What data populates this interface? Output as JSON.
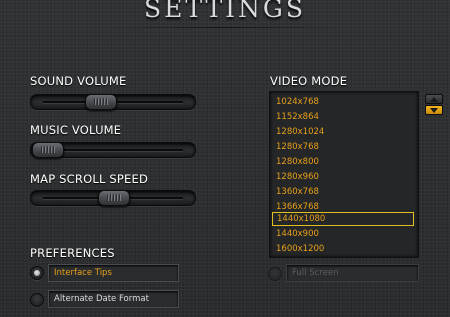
{
  "title": "SETTINGS",
  "sliders": [
    {
      "label": "SOUND VOLUME",
      "value": 0.4
    },
    {
      "label": "MUSIC VOLUME",
      "value": 0.0
    },
    {
      "label": "MAP SCROLL SPEED",
      "value": 0.5
    }
  ],
  "video_mode": {
    "label": "VIDEO MODE",
    "items": [
      "1024x768",
      "1152x864",
      "1280x1024",
      "1280x768",
      "1280x800",
      "1280x960",
      "1360x768",
      "1366x768",
      "1440x1080",
      "1440x900",
      "1600x1200"
    ],
    "selected": "1440x1080",
    "full_screen": {
      "label": "Full Screen",
      "checked": false,
      "enabled": false
    }
  },
  "preferences": {
    "label": "PREFERENCES",
    "options": [
      {
        "label": "Interface Tips",
        "checked": true
      },
      {
        "label": "Alternate Date Format",
        "checked": false
      }
    ]
  },
  "colors": {
    "accent": "#e8a01a",
    "selection_border": "#e0c020",
    "background": "#2d2f31"
  }
}
